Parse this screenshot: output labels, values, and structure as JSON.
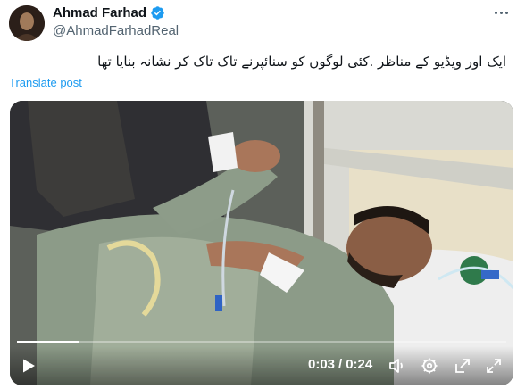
{
  "author": {
    "display_name": "Ahmad Farhad",
    "handle": "@AhmadFarhadReal",
    "verified_color": "#1d9bf0"
  },
  "post": {
    "text": "ایک اور ویڈیو کے مناظر .کئی لوگوں کو سنائپرنے تاک تاک کر نشانہ بنایا تھا",
    "translate_label": "Translate post"
  },
  "video": {
    "current_time": "0:03",
    "separator": "/",
    "duration": "0:24",
    "progress_fraction": 0.125,
    "controls": [
      "play-icon",
      "volume-icon",
      "settings-icon",
      "pop-out-icon",
      "fullscreen-icon"
    ]
  },
  "colors": {
    "accent": "#1d9bf0",
    "text": "#0f1419",
    "muted": "#536471"
  }
}
